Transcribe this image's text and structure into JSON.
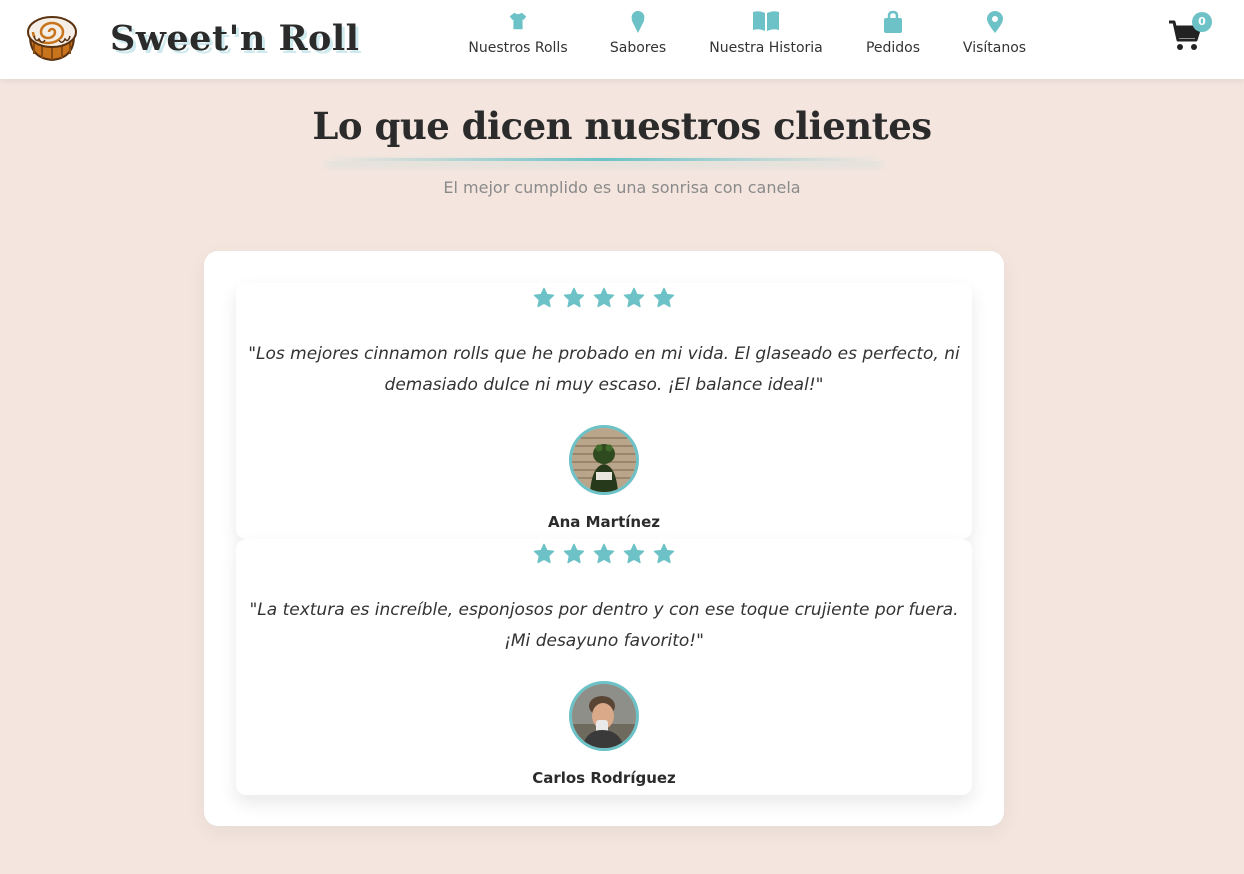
{
  "header": {
    "brand": "Sweet'n Roll",
    "logo_icon": "cinnamon-roll-icon",
    "nav": [
      {
        "label": "Nuestros Rolls",
        "icon": "tshirt-icon"
      },
      {
        "label": "Sabores",
        "icon": "ice-cream-icon"
      },
      {
        "label": "Nuestra Historia",
        "icon": "book-icon"
      },
      {
        "label": "Pedidos",
        "icon": "shopping-bag-icon"
      },
      {
        "label": "Visítanos",
        "icon": "map-pin-icon"
      }
    ],
    "cart": {
      "icon": "cart-icon",
      "count": "0"
    }
  },
  "section": {
    "title": "Lo que dicen nuestros clientes",
    "subtitle": "El mejor cumplido es una sonrisa con canela"
  },
  "testimonials": [
    {
      "rating": 5,
      "quote": "\"Los mejores cinnamon rolls que he probado en mi vida. El glaseado es perfecto, ni demasiado dulce ni muy escaso. ¡El balance ideal!\"",
      "name": "Ana Martínez"
    },
    {
      "rating": 5,
      "quote": "\"La textura es increíble, esponjosos por dentro y con ese toque crujiente por fuera. ¡Mi desayuno favorito!\"",
      "name": "Carlos Rodríguez"
    }
  ],
  "colors": {
    "accent": "#6cc2c7",
    "background": "#f4e6df",
    "text": "#333333"
  }
}
